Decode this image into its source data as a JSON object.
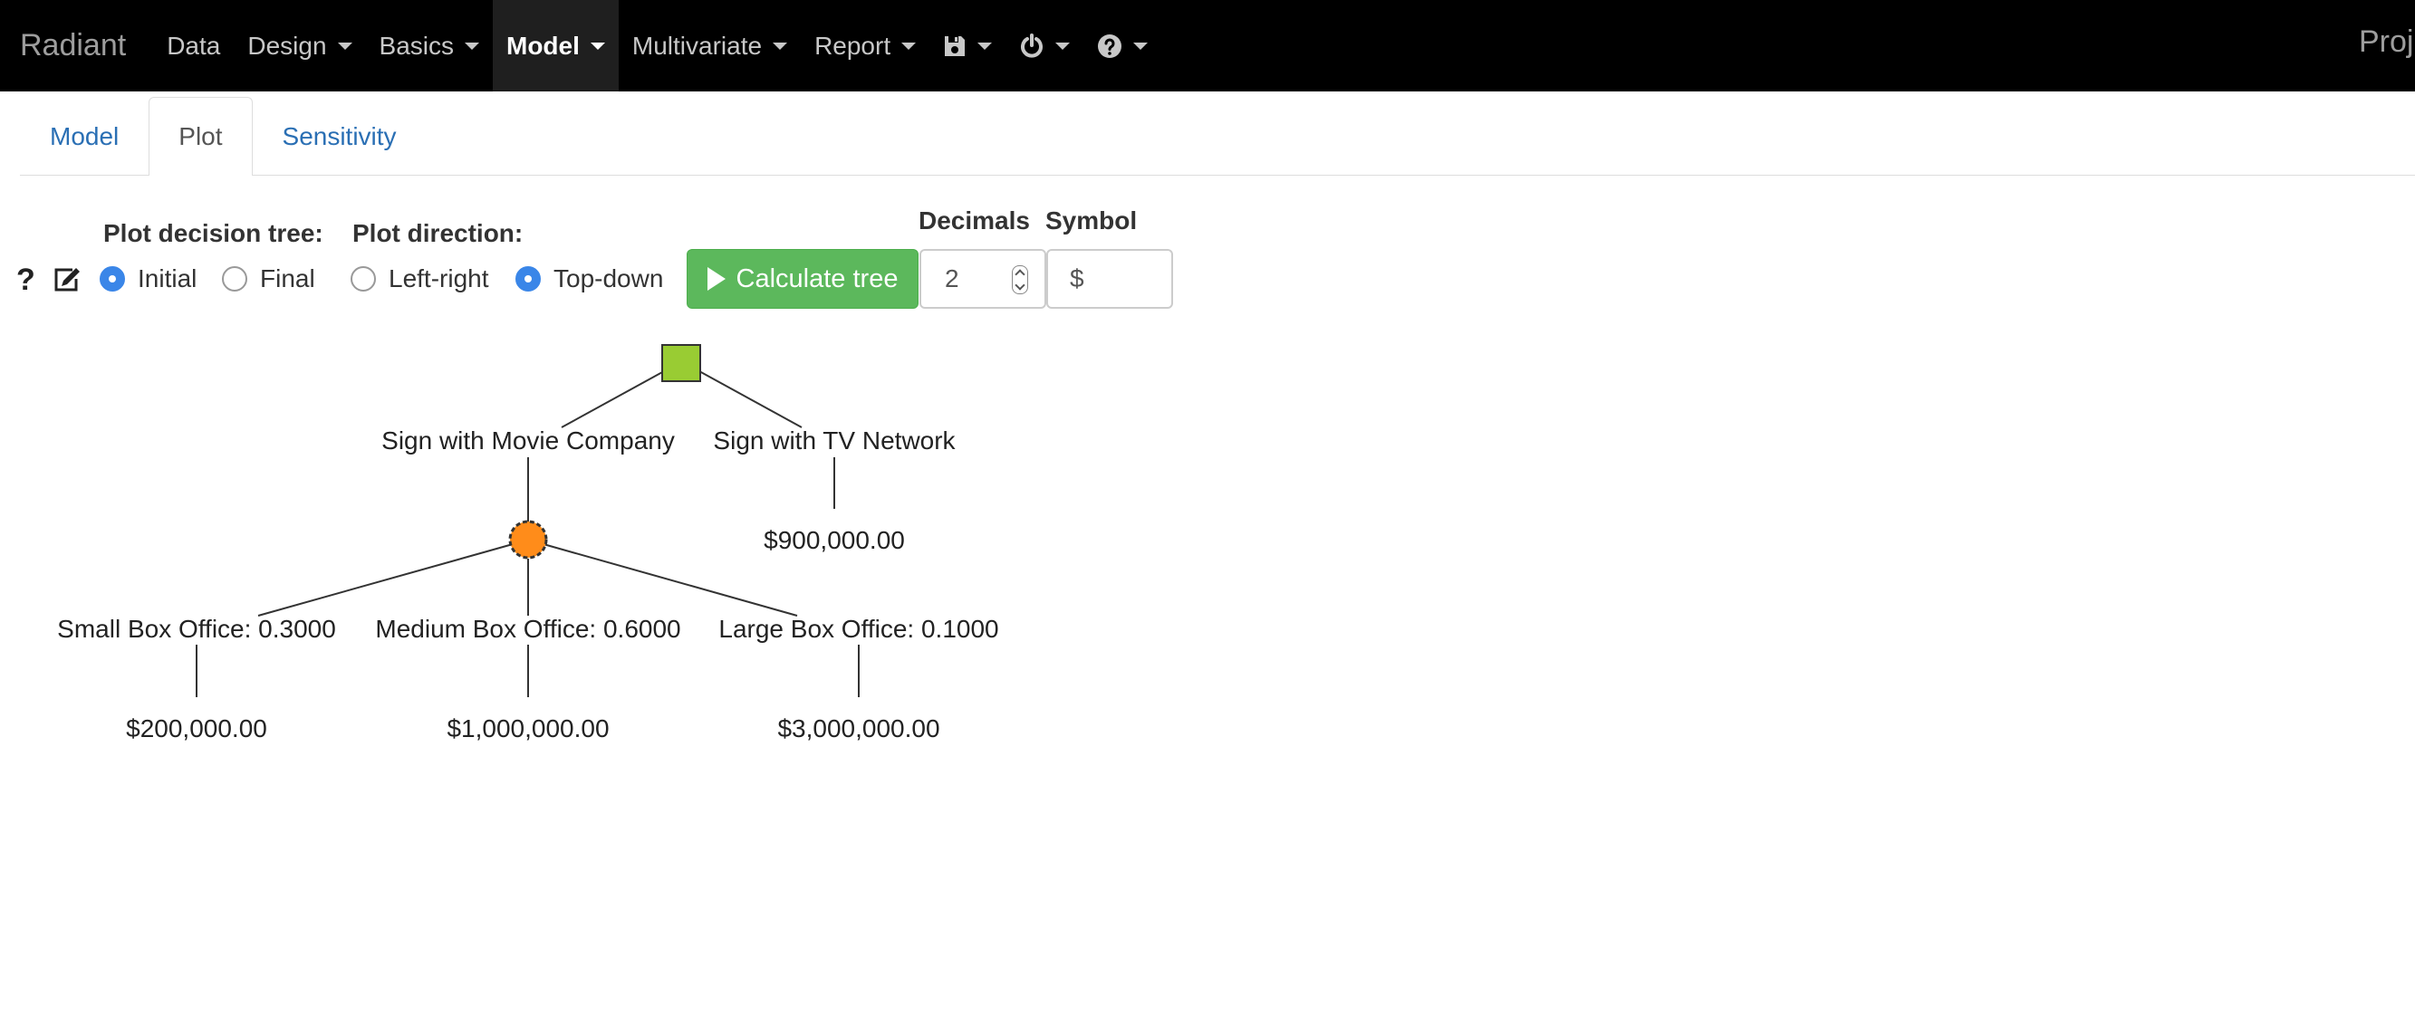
{
  "navbar": {
    "brand": "Radiant",
    "items": [
      {
        "label": "Data"
      },
      {
        "label": "Design"
      },
      {
        "label": "Basics"
      },
      {
        "label": "Model"
      },
      {
        "label": "Multivariate"
      },
      {
        "label": "Report"
      }
    ],
    "icons": [
      "save-icon",
      "power-icon",
      "question-circle-icon"
    ],
    "right_text": "Proj"
  },
  "tabs": [
    {
      "label": "Model"
    },
    {
      "label": "Plot"
    },
    {
      "label": "Sensitivity"
    }
  ],
  "controls": {
    "plot_tree_label": "Plot decision tree:",
    "plot_tree_options": [
      {
        "label": "Initial",
        "checked": true
      },
      {
        "label": "Final",
        "checked": false
      }
    ],
    "plot_direction_label": "Plot direction:",
    "plot_direction_options": [
      {
        "label": "Left-right",
        "checked": false
      },
      {
        "label": "Top-down",
        "checked": true
      }
    ],
    "calculate_label": "Calculate tree",
    "decimals_label": "Decimals",
    "decimals_value": "2",
    "symbol_label": "Symbol",
    "symbol_value": "$",
    "accent_color": "#5cb85c"
  },
  "tree": {
    "decision_color": "#99cc33",
    "chance_color": "#ff8c1a",
    "branches": {
      "movie": "Sign with Movie Company",
      "tv": "Sign with TV Network"
    },
    "tv_payoff": "$900,000.00",
    "outcomes": [
      {
        "label": "Small Box Office: 0.3000",
        "payoff": "$200,000.00"
      },
      {
        "label": "Medium Box Office: 0.6000",
        "payoff": "$1,000,000.00"
      },
      {
        "label": "Large Box Office: 0.1000",
        "payoff": "$3,000,000.00"
      }
    ]
  }
}
